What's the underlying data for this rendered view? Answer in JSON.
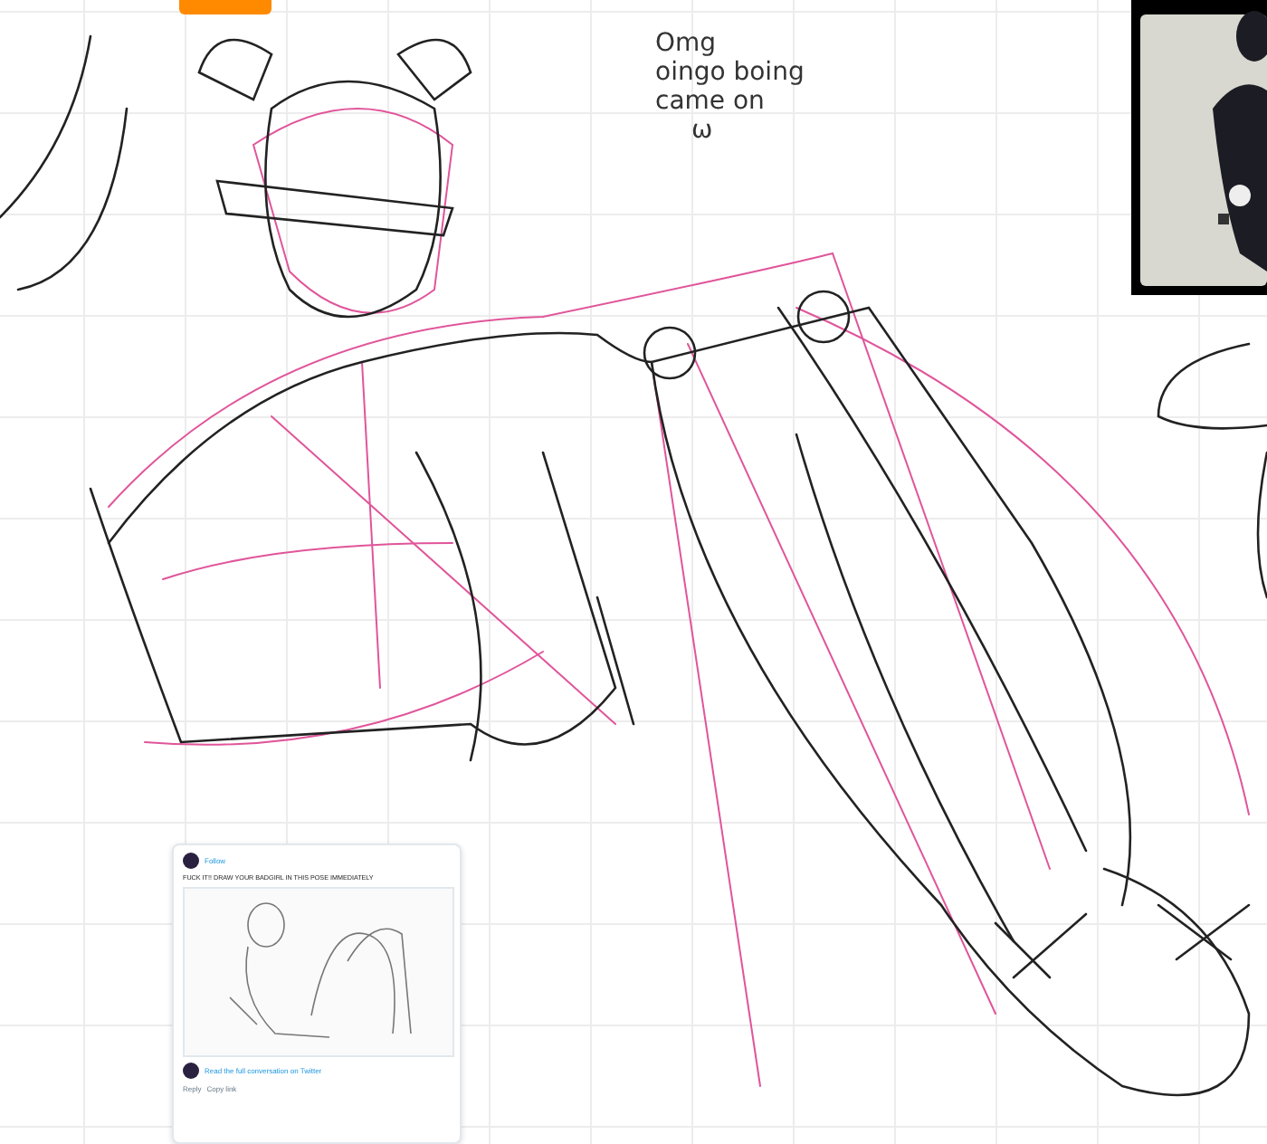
{
  "note": {
    "lines": [
      "Omg",
      "oingo boing",
      "came on",
      "ω"
    ]
  },
  "tweet": {
    "follow": "Follow",
    "text": "FUCK IT!! DRAW YOUR BADGIRL IN THIS POSE IMMEDIATELY",
    "footer_link": "Read the full conversation on Twitter",
    "actions": [
      "Reply",
      "Copy link"
    ]
  }
}
